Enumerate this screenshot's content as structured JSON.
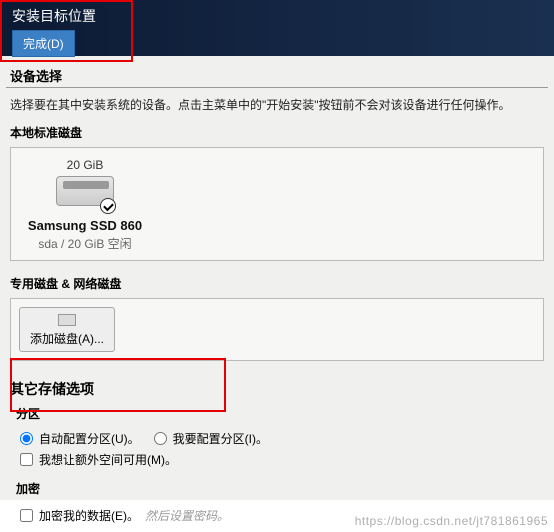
{
  "header": {
    "title": "安装目标位置",
    "done": "完成(D)"
  },
  "device": {
    "section": "设备选择",
    "hint": "选择要在其中安装系统的设备。点击主菜单中的\"开始安装\"按钮前不会对该设备进行任何操作。",
    "local": "本地标准磁盘",
    "disk": {
      "size": "20 GiB",
      "name": "Samsung SSD 860",
      "sub": "sda  /  20 GiB 空闲"
    },
    "net_label": "专用磁盘 & 网络磁盘",
    "add_disk": "添加磁盘(A)..."
  },
  "other": {
    "title": "其它存储选项",
    "partition": "分区",
    "auto": "自动配置分区(U)。",
    "manual": "我要配置分区(I)。",
    "extra": "我想让额外空间可用(M)。",
    "encrypt_title": "加密",
    "encrypt": "加密我的数据(E)。",
    "encrypt_hint": "然后设置密码。"
  },
  "watermark": "https://blog.csdn.net/jt781861965"
}
